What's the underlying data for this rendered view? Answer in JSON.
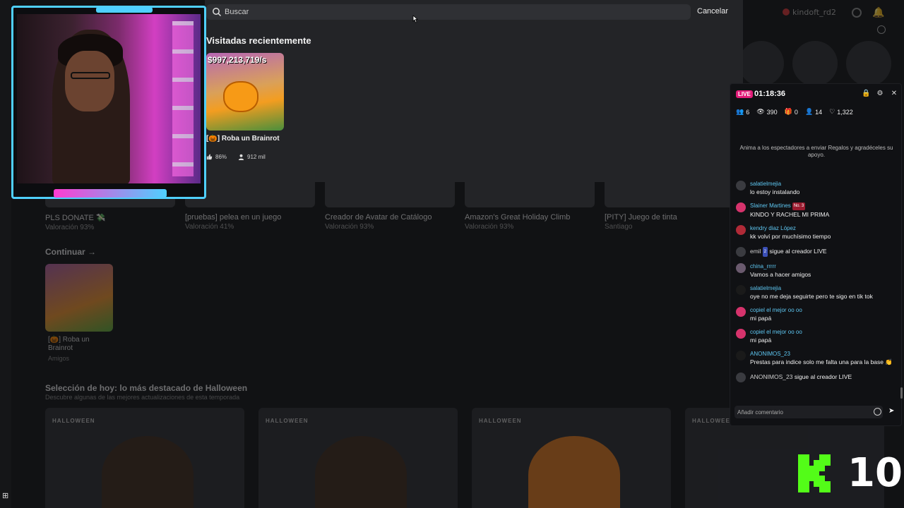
{
  "background": {
    "username": "kindoft_rd2",
    "game_row": [
      {
        "title": "PLS DONATE 💸",
        "sub": "Valoración 93%"
      },
      {
        "title": "[pruebas] pelea en un juego",
        "sub": "Valoración 41%"
      },
      {
        "title": "Creador de Avatar de Catálogo",
        "sub": "Valoración 93%"
      },
      {
        "title": "Amazon's Great Holiday Climb",
        "sub": "Valoración 93%"
      },
      {
        "title": "[PITY] Juego de tinta",
        "sub": "Santiago"
      }
    ],
    "continue_title": "Continuar →",
    "continue_card": {
      "title": "[🎃] Roba un Brainrot",
      "sub": "Amigos"
    },
    "section_title": "Selección de hoy: lo más destacado de Halloween",
    "section_sub": "Descubre algunas de las mejores actualizaciones de esta temporada",
    "halloween_label": "HALLOWEEN"
  },
  "search": {
    "placeholder": "Buscar",
    "cancel_label": "Cancelar",
    "recent_title": "Visitadas recientemente",
    "recent_card": {
      "thumb_price": "$997,213,719/s",
      "name": "[🎃] Roba un Brainrot",
      "rating": "86%",
      "players": "912 mil"
    }
  },
  "live": {
    "badge": "LIVE",
    "duration": "01:18:36",
    "stats": {
      "viewers_small": "6",
      "views": "390",
      "gifts": "0",
      "subs": "14",
      "likes": "1,322"
    },
    "gift_prompt": "Anima a los espectadores a enviar Regalos y agradéceles su apoyo.",
    "comment_placeholder": "Añadir comentario",
    "messages": [
      {
        "user": "salatielmejia",
        "text": "lo estoy instalando"
      },
      {
        "user": "Slainer Martines",
        "rank": "No. 3",
        "text": "KINDO Y RACHEL MI PRIMA"
      },
      {
        "user": "kendry diaz López",
        "text": "kk volví por muchísimo tiempo"
      },
      {
        "user": "emil",
        "badge": "2",
        "text": "sigue al creador LIVE"
      },
      {
        "user": "china_rrrrr",
        "text": "Vamos a hacer amigos"
      },
      {
        "user": "salatielmejia",
        "text": "oye no me deja seguirte pero te sigo en tik tok"
      },
      {
        "user": "copiel el mejor oo oo",
        "text": "mi papá"
      },
      {
        "user": "copiel el mejor oo oo",
        "text": "mi papá"
      },
      {
        "user": "ANONIMOS_23",
        "text": "Prestas para indice solo me falta una para la base 👏"
      },
      {
        "user": "ANONIMOS_23",
        "text": "sigue al creador LIVE"
      }
    ]
  },
  "overlay": {
    "kick_count": "10"
  },
  "colors": {
    "accent_live": "#e01b78",
    "chat_user": "#5ec7f2",
    "cam_frame": "#4fd0ff",
    "kick_green": "#53fc18"
  }
}
